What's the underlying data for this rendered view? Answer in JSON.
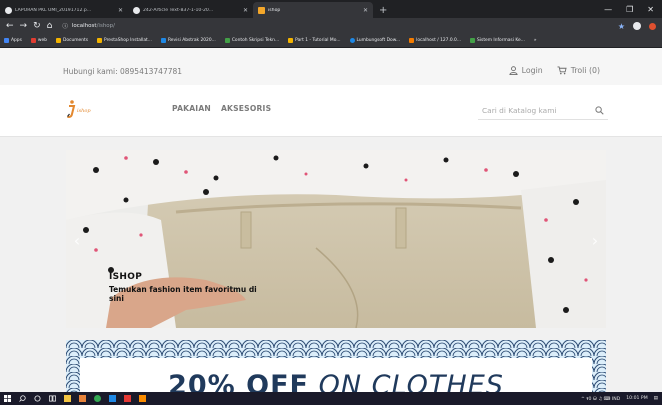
{
  "browser": {
    "tabs": [
      {
        "title": "LAPORAN PKL UMI_20191712.p...",
        "active": false
      },
      {
        "title": "242-Article Text-837-1-10-20...",
        "active": false
      },
      {
        "title": "ishop",
        "active": true
      }
    ],
    "new_tab": "+",
    "address": {
      "host": "localhost",
      "path": "/ishop/"
    },
    "bookmarks": [
      {
        "label": "Apps",
        "color": "#e8453c"
      },
      {
        "label": "web",
        "color": "#e03c31"
      },
      {
        "label": "Documents",
        "color": "#f4b400"
      },
      {
        "label": "PrestaShop Installat...",
        "color": "#f4b400"
      },
      {
        "label": "Revisi Abstrak 2020...",
        "color": "#1e88e5"
      },
      {
        "label": "Contoh Skripsi Tekn...",
        "color": "#43a047"
      },
      {
        "label": "Part 1 - Tutorial Mo...",
        "color": "#f4b400"
      },
      {
        "label": "Lumbungsoft Dow...",
        "color": "#1e88e5"
      },
      {
        "label": "localhost / 127.0.0...",
        "color": "#f57c00"
      },
      {
        "label": "Sistem Informasi Ke...",
        "color": "#43a047"
      }
    ]
  },
  "header": {
    "contact": "Hubungi kami: 0895413747781",
    "login": "Login",
    "cart": "Troli (0)"
  },
  "logo": {
    "text": "ishop",
    "color": "#e3882f"
  },
  "nav": {
    "items": [
      "PAKAIAN",
      "AKSESORIS"
    ]
  },
  "search": {
    "placeholder": "Cari di Katalog kami"
  },
  "slider": {
    "title": "ISHOP",
    "text": "Temukan fashion item favoritmu di sini"
  },
  "banner": {
    "bold": "20% OFF",
    "rest": "ON CLOTHES"
  },
  "taskbar": {
    "tray_text": "^ ፃ0 ⛁ ♫ ⌨ IND",
    "time": "10:01 PM"
  }
}
